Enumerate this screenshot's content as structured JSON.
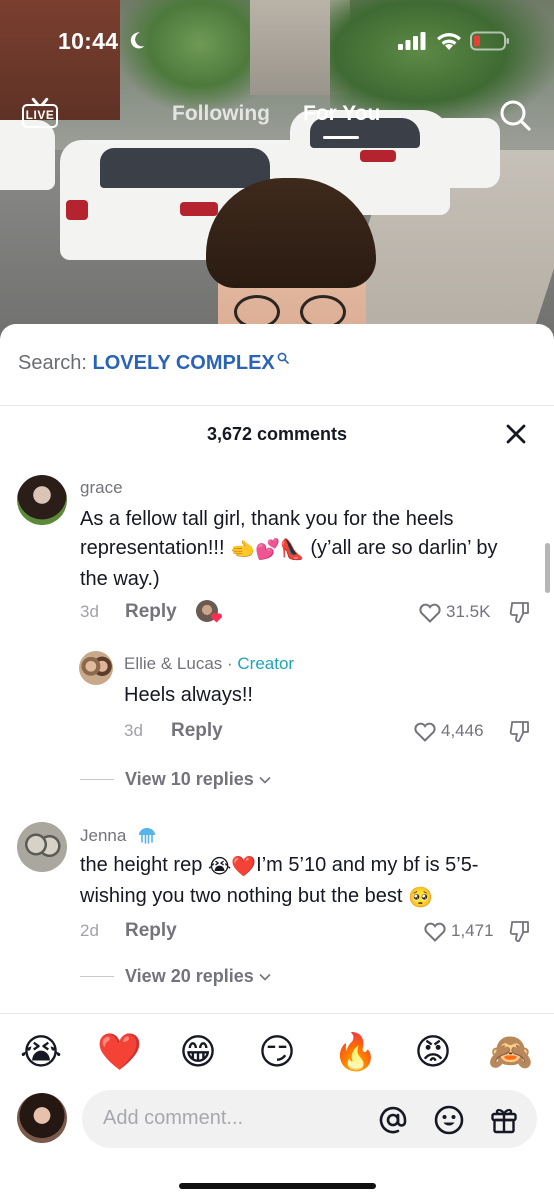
{
  "status_bar": {
    "time": "10:44"
  },
  "top_nav": {
    "live_label": "LIVE",
    "tab_following": "Following",
    "tab_for_you": "For You"
  },
  "search_suggest": {
    "prefix": "Search: ",
    "keyword": "LOVELY COMPLEX"
  },
  "comments_header": {
    "count_label": "3,672 comments"
  },
  "comments": [
    {
      "username": "grace",
      "text_part1": "As a fellow tall girl, thank you for the heels representation!!! ",
      "text_part2": " (y’all are so darlin’ by the way.)",
      "time": "3d",
      "reply_label": "Reply",
      "likes": "31.5K"
    },
    {
      "username": "Ellie & Lucas",
      "separator": " · ",
      "creator_tag": "Creator",
      "text": "Heels always!!",
      "time": "3d",
      "reply_label": "Reply",
      "likes": "4,446"
    },
    {
      "username": "Jenna",
      "text_part1": "the height rep ",
      "text_part2": "I’m 5’10 and my bf is 5’5- wishing you two nothing but the best ",
      "time": "2d",
      "reply_label": "Reply",
      "likes": "1,471"
    }
  ],
  "view_replies": [
    "View 10 replies",
    "View 20 replies"
  ],
  "emoji_bar": [
    "😭",
    "❤️",
    "😁",
    "😏",
    "🔥",
    "😡",
    "🙈"
  ],
  "inline_emojis": {
    "grace": "🫲💕👠",
    "jenna_a": "😭❤️",
    "jenna_b": "🥺"
  },
  "comment_input": {
    "placeholder": "Add comment..."
  },
  "icons": [
    "moon-icon",
    "signal-icon",
    "wifi-icon",
    "battery-icon",
    "live-icon",
    "search-icon",
    "close-icon",
    "heart-icon",
    "dislike-icon",
    "chevron-down-icon",
    "at-icon",
    "emoji-icon",
    "gift-icon"
  ],
  "colors": {
    "keyword": "#2b64b6",
    "creator": "#20a4b8",
    "text_primary": "#161823",
    "text_secondary": "#73747b"
  }
}
